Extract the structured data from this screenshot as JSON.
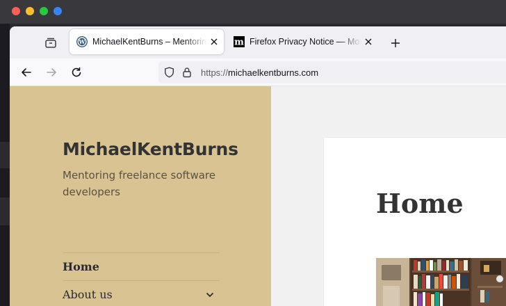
{
  "window": {
    "traffic_lights": [
      {
        "name": "close",
        "color": "#ff5f57"
      },
      {
        "name": "minimize",
        "color": "#febc2e"
      },
      {
        "name": "zoom",
        "color": "#28c840"
      },
      {
        "name": "extra",
        "color": "#3b82f6"
      }
    ]
  },
  "tabs": [
    {
      "title": "MichaelKentBurns – Mentoring freelance software developers",
      "favicon": "wordpress-icon",
      "active": true
    },
    {
      "title": "Firefox Privacy Notice — Mozilla",
      "favicon": "mozilla-m-icon",
      "active": false
    }
  ],
  "toolbar": {
    "url_protocol": "https://",
    "url_host": "michaelkentburns.com"
  },
  "site": {
    "title": "MichaelKentBurns",
    "description": "Mentoring freelance software developers",
    "sidebar_color": "#d9c392",
    "menu": [
      {
        "label": "Home",
        "current": true,
        "has_submenu": false
      },
      {
        "label": "About us",
        "current": false,
        "has_submenu": true
      }
    ]
  },
  "content": {
    "page_title": "Home"
  }
}
